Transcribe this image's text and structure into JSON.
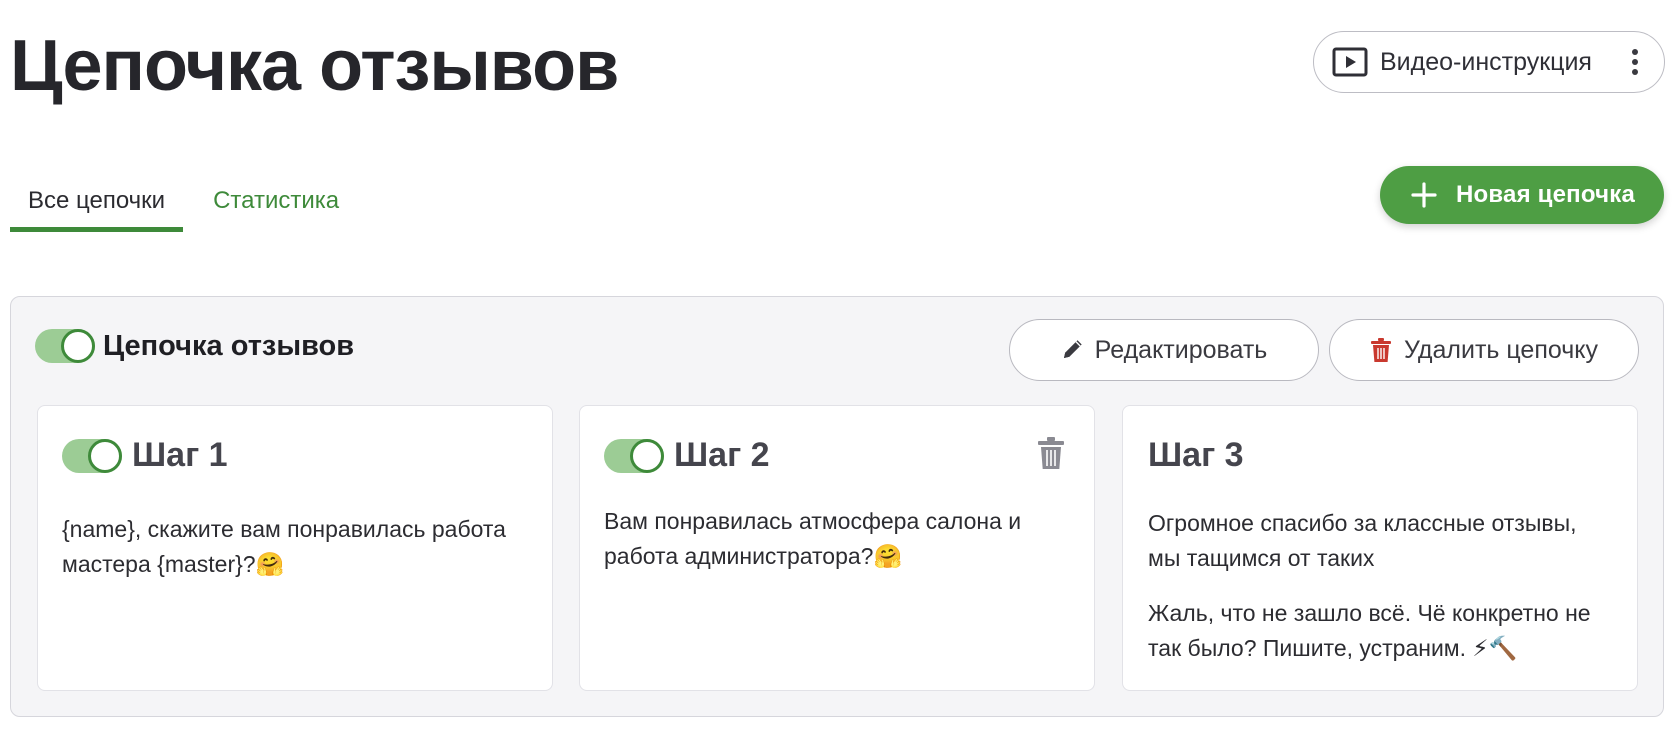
{
  "page": {
    "title": "Цепочка отзывов"
  },
  "header": {
    "video_button_label": "Видео-инструкция"
  },
  "tabs": [
    {
      "label": "Все цепочки",
      "active": true
    },
    {
      "label": "Статистика",
      "active": false
    }
  ],
  "new_chain_button": {
    "label": "Новая цепочка"
  },
  "chain": {
    "title": "Цепочка отзывов",
    "enabled": true,
    "edit_label": "Редактировать",
    "delete_label": "Удалить цепочку",
    "steps": [
      {
        "title": "Шаг 1",
        "enabled": true,
        "has_toggle": true,
        "has_delete": false,
        "text": "{name}, скажите вам понравилась работа мастера {master}?🤗"
      },
      {
        "title": "Шаг 2",
        "enabled": true,
        "has_toggle": true,
        "has_delete": true,
        "text": "Вам понравилась атмосфера салона и работа администратора?🤗"
      },
      {
        "title": "Шаг 3",
        "has_toggle": false,
        "has_delete": false,
        "text": "Огромное спасибо за классные отзывы, мы тащимся от таких",
        "text2": "Жаль, что не зашло всё. Чё конкретно не так было? Пишите, устраним. ⚡🔨"
      }
    ]
  },
  "colors": {
    "accent": "#4e9e44",
    "accent_dark": "#3e8a3a",
    "toggle_track": "#9ccc95",
    "delete_icon": "#c9392f"
  },
  "icons": {
    "video": "play-icon",
    "menu": "kebab-icon",
    "add": "plus-icon",
    "edit": "pencil-icon",
    "delete": "trash-icon"
  }
}
